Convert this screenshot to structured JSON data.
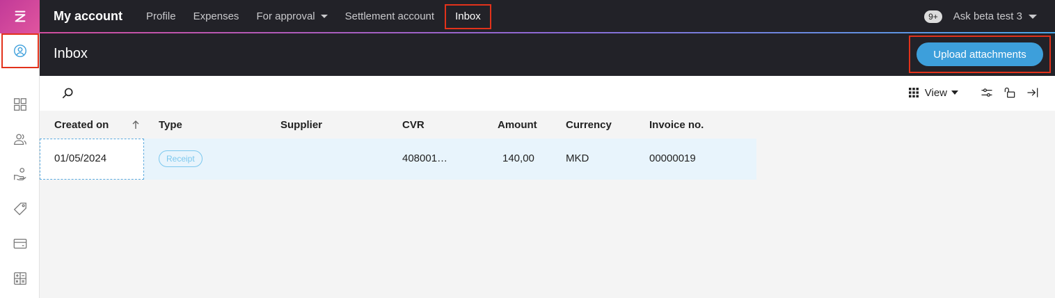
{
  "nav": {
    "brand": "My account",
    "items": [
      {
        "label": "Profile"
      },
      {
        "label": "Expenses"
      },
      {
        "label": "For approval"
      },
      {
        "label": "Settlement account"
      },
      {
        "label": "Inbox"
      }
    ],
    "notification_badge": "9+",
    "user_name": "Ask beta test 3"
  },
  "page": {
    "title": "Inbox",
    "upload_label": "Upload attachments"
  },
  "toolbar": {
    "view_label": "View"
  },
  "table": {
    "headers": [
      "Created on",
      "Type",
      "Supplier",
      "CVR",
      "Amount",
      "Currency",
      "Invoice no."
    ],
    "rows": [
      {
        "created_on": "01/05/2024",
        "type": "Receipt",
        "supplier": "",
        "cvr": "408001…",
        "amount": "140,00",
        "currency": "MKD",
        "invoice_no": "00000019"
      }
    ]
  },
  "colors": {
    "accent": "#3d9fdb",
    "header_bg": "#222228",
    "highlight": "#e2321b",
    "brand_pink": "#d14d9e"
  },
  "rail": {
    "icons": [
      "logo-icon",
      "user-icon",
      "dashboard-icon",
      "people-icon",
      "hand-money-icon",
      "tag-icon",
      "card-icon",
      "calculator-icon"
    ]
  }
}
